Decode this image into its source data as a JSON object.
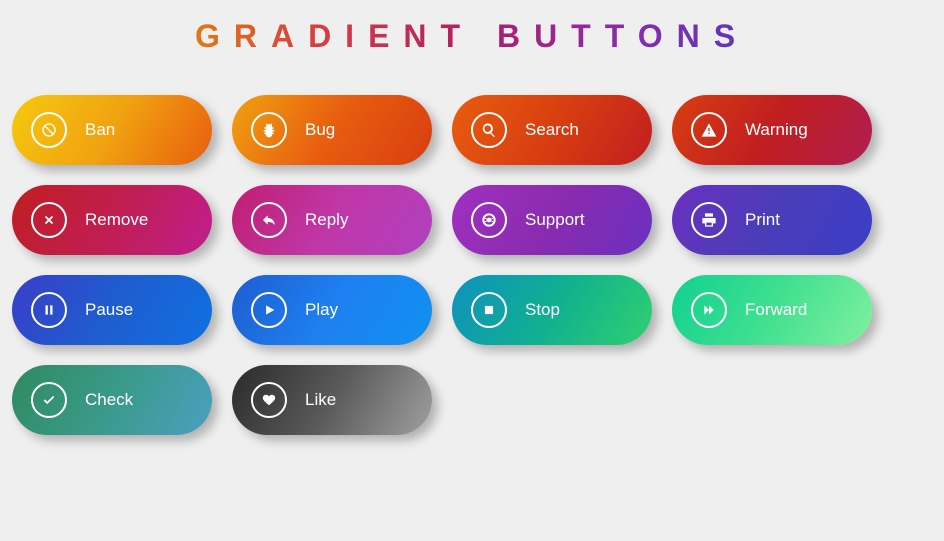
{
  "title": "GRADIENT BUTTONS",
  "buttons": {
    "ban": {
      "label": "Ban"
    },
    "bug": {
      "label": "Bug"
    },
    "search": {
      "label": "Search"
    },
    "warning": {
      "label": "Warning"
    },
    "remove": {
      "label": "Remove"
    },
    "reply": {
      "label": "Reply"
    },
    "support": {
      "label": "Support"
    },
    "print": {
      "label": "Print"
    },
    "pause": {
      "label": "Pause"
    },
    "play": {
      "label": "Play"
    },
    "stop": {
      "label": "Stop"
    },
    "forward": {
      "label": "Forward"
    },
    "check": {
      "label": "Check"
    },
    "like": {
      "label": "Like"
    }
  }
}
